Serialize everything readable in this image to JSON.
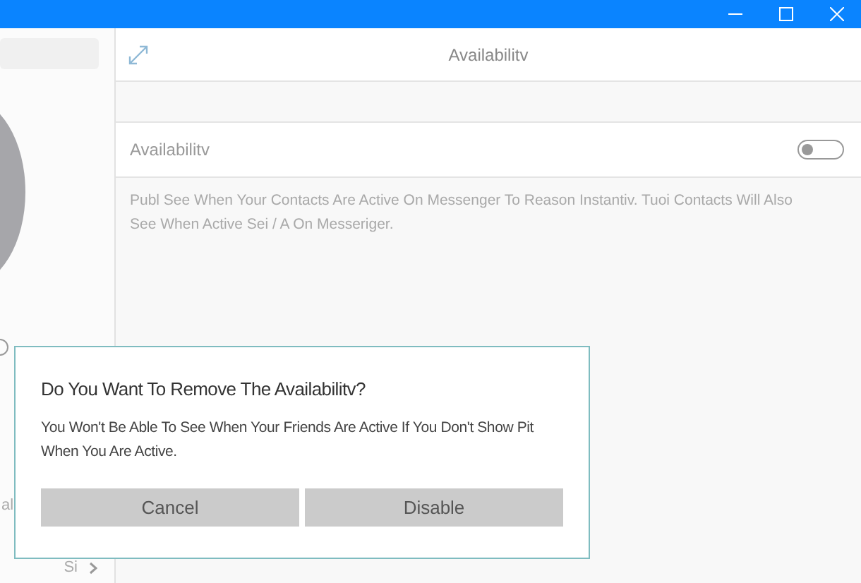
{
  "window": {
    "title": "Availabilitv"
  },
  "sidebar": {
    "items": [
      {
        "label": "al"
      },
      {
        "label": "Si"
      }
    ]
  },
  "setting": {
    "label": "Availabilitv",
    "on": false,
    "description": "Publ See When Your Contacts Are Active On Messenger To Reason Instantiv. Tuoi Contacts Will Also See When Active Sei / A On Messeriger."
  },
  "dialog": {
    "title": "Do You Want To Remove The Availabilitv?",
    "message": "You Won't Be Able To See When Your Friends Are Active If You Don't Show Pit When You Are Active.",
    "buttons": [
      "Cancel",
      "Disable"
    ]
  }
}
